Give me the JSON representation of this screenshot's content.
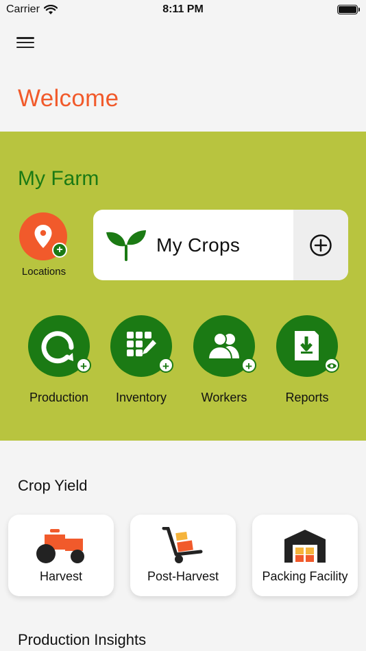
{
  "status": {
    "carrier": "Carrier",
    "time": "8:11 PM"
  },
  "header": {
    "welcome": "Welcome"
  },
  "farm": {
    "title": "My Farm",
    "locations_label": "Locations",
    "crops_label": "My Crops",
    "actions": [
      {
        "label": "Production",
        "badge": "+"
      },
      {
        "label": "Inventory",
        "badge": "+"
      },
      {
        "label": "Workers",
        "badge": "+"
      },
      {
        "label": "Reports",
        "badge": "view"
      }
    ]
  },
  "crop_yield": {
    "title": "Crop Yield",
    "cards": [
      {
        "label": "Harvest",
        "icon": "tractor-icon"
      },
      {
        "label": "Post-Harvest",
        "icon": "hand-truck-icon"
      },
      {
        "label": "Packing Facility",
        "icon": "warehouse-icon"
      }
    ]
  },
  "insights": {
    "title": "Production Insights"
  },
  "colors": {
    "accent": "#f15a2b",
    "farm_bg": "#b8c43f",
    "green": "#1b7a14"
  }
}
